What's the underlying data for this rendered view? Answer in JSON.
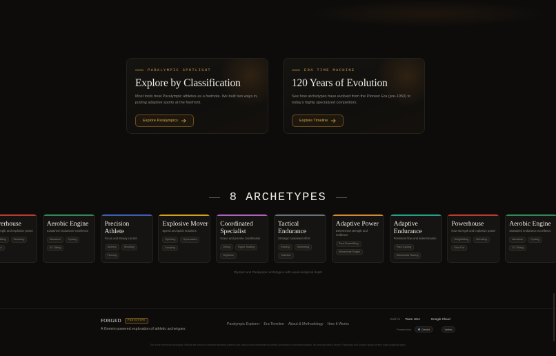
{
  "features": [
    {
      "eyebrow": "PARALYMPIC SPOTLIGHT",
      "title": "Explore by Classification",
      "body": "Most tools treat Paralympic athletes as a footnote. We built two ways in, putting adaptive sports at the forefront.",
      "button": "Explore Paralympics"
    },
    {
      "eyebrow": "ERA TIME MACHINE",
      "title": "120 Years of Evolution",
      "body": "See how archetypes have evolved from the Pioneer Era (pre-1950) to today's highly specialized competitors.",
      "button": "Explore Timeline"
    }
  ],
  "archetypes_heading": "8 ARCHETYPES",
  "archetypes": [
    {
      "name": "Powerhouse",
      "desc": "Raw strength and explosive power",
      "tags": [
        "Weightlifting",
        "Wrestling",
        "Shot Put"
      ],
      "color": "#c0392b"
    },
    {
      "name": "Aerobic Engine",
      "desc": "Sustained endurance excellence",
      "tags": [
        "Marathon",
        "Cycling",
        "XC Skiing"
      ],
      "color": "#2e8b57"
    },
    {
      "name": "Precision Athlete",
      "desc": "Focus and steady control",
      "tags": [
        "Archery",
        "Shooting",
        "Fencing"
      ],
      "color": "#3b5fc0"
    },
    {
      "name": "Explosive Mover",
      "desc": "Speed and quick reactions",
      "tags": [
        "Sprinting",
        "Gymnastics",
        "Jumping"
      ],
      "color": "#d4a017"
    },
    {
      "name": "Coordinated Specialist",
      "desc": "Grace and precise coordination",
      "tags": [
        "Diving",
        "Figure Skating",
        "Rhythmic"
      ],
      "color": "#b05fc4"
    },
    {
      "name": "Tactical Endurance",
      "desc": "Strategic sustained effort",
      "tags": [
        "Rowing",
        "Swimming",
        "Triathlon"
      ],
      "color": "#6a6f7a"
    },
    {
      "name": "Adaptive Power",
      "desc": "Determined strength and resilience",
      "tags": [
        "Para Powerlifting",
        "Wheelchair Rugby"
      ],
      "color": "#d48a2e"
    },
    {
      "name": "Adaptive Endurance",
      "desc": "Persistent flow and determination",
      "tags": [
        "Para Cycling",
        "Wheelchair Racing"
      ],
      "color": "#1fa38a"
    },
    {
      "name": "Powerhouse",
      "desc": "Raw strength and explosive power",
      "tags": [
        "Weightlifting",
        "Wrestling",
        "Shot Put"
      ],
      "color": "#c0392b"
    },
    {
      "name": "Aerobic Engine",
      "desc": "Sustained endurance excellence",
      "tags": [
        "Marathon",
        "Cycling",
        "XC Skiing"
      ],
      "color": "#2e8b57"
    }
  ],
  "caption": "Olympic and Paralympic archetypes with equal analytical depth",
  "footer": {
    "logo": "FORGED",
    "badge": "PROTOTYPE",
    "tagline": "A Gemini-powered exploration of athletic archetypes",
    "nav": [
      "Paralympic Explorer",
      "Era Timeline",
      "About & Methodology",
      "How It Works"
    ],
    "built_for_label": "Built for",
    "built_for": [
      "Team USA",
      "Google Cloud"
    ],
    "powered_by_label": "Powered by",
    "powered_by": [
      "Gemini",
      "Vertex"
    ],
    "disclaimer": "This is the experience prototype. Results are based on historical biometric patterns and should not be interpreted as athletic predictions or recommendations. No personal data is stored. Paralympic and Olympic sports receive equal analytical depth."
  }
}
